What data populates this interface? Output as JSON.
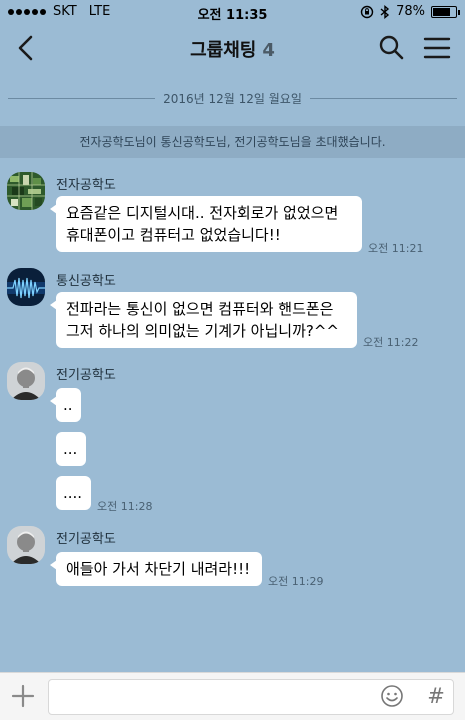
{
  "status_bar": {
    "carrier": "SKT",
    "network": "LTE",
    "time": "오전 11:35",
    "battery": "78%",
    "battery_level": 0.78
  },
  "header": {
    "title": "그룹채팅",
    "member_count": "4",
    "back_icon": "chevron-left-icon",
    "search_icon": "search-icon",
    "menu_icon": "hamburger-menu-icon"
  },
  "date_divider": "2016년 12월 12일 월요일",
  "system_notice": "전자공학도님이 통신공학도님, 전기공학도님을 초대했습니다.",
  "messages": [
    {
      "sender": "전자공학도",
      "lines": [
        "요즘같은 디지털시대.. 전자회로가 없었으면",
        "휴대폰이고 컴퓨터고 없었습니다!!"
      ],
      "time": "오전 11:21"
    },
    {
      "sender": "통신공학도",
      "lines": [
        "전파라는 통신이 없으면 컴퓨터와 핸드폰은",
        "그저 하나의 의미없는 기계가 아닙니까?^^"
      ],
      "time": "오전 11:22"
    },
    {
      "sender": "전기공학도",
      "bubbles": [
        "..",
        "...",
        "...."
      ],
      "time": "오전 11:28"
    },
    {
      "sender": "전기공학도",
      "text": "애들아 가서 차단기 내려라!!!",
      "time": "오전 11:29"
    }
  ],
  "input_bar": {
    "value": "",
    "plus_icon": "plus-icon",
    "emoji_icon": "emoji-icon",
    "hash_label": "#"
  },
  "colors": {
    "chat_background": "#9bbbd4",
    "bubble": "#ffffff",
    "input_bar": "#f5f5f5"
  }
}
